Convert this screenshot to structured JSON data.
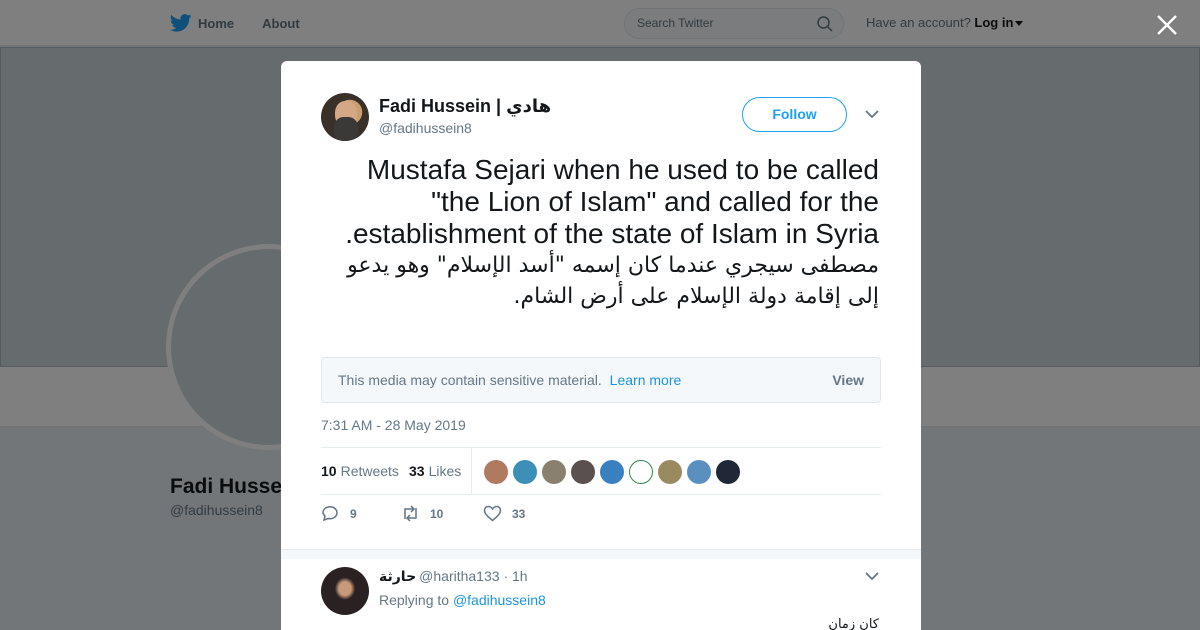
{
  "nav": {
    "home_label": "Home",
    "about_label": "About",
    "search_placeholder": "Search Twitter",
    "account_prompt": "Have an account?",
    "login_label": "Log in"
  },
  "background_profile": {
    "name": "Fadi Husse",
    "handle": "@fadihussein8"
  },
  "tweet": {
    "author_name": "Fadi Hussein | هادي",
    "author_handle": "@fadihussein8",
    "follow_label": "Follow",
    "text_en": "Mustafa Sejari when he used to be called \"the Lion of Islam\" and called for the establishment of the state of Islam in Syria.",
    "text_ar": "مصطفى سيجري عندما كان إسمه \"أسد الإسلام\" وهو يدعو إلى إقامة دولة الإسلام على أرض الشام.",
    "sensitive_text": "This media may contain sensitive material.",
    "learn_more": "Learn more",
    "view_label": "View",
    "timestamp": "7:31 AM - 28 May 2019",
    "retweets_count": "10",
    "retweets_label": "Retweets",
    "likes_count": "33",
    "likes_label": "Likes",
    "liker_colors": [
      "#b07a60",
      "#3d8fb8",
      "#8a8070",
      "#5a5050",
      "#3a80c0",
      "#ffffff",
      "#9a8a60",
      "#5a90c0",
      "#202838"
    ],
    "reply_count": "9",
    "retweet_action_count": "10",
    "like_action_count": "33"
  },
  "reply": {
    "name": "حارثة",
    "handle": "@haritha133",
    "time": "· 1h",
    "replying_prefix": "Replying to",
    "replying_handle": "@fadihussein8",
    "text": "كان زمان"
  },
  "colors": {
    "accent": "#1da1f2",
    "twitter_blue": "#1da1f2",
    "muted_text": "#657786"
  }
}
